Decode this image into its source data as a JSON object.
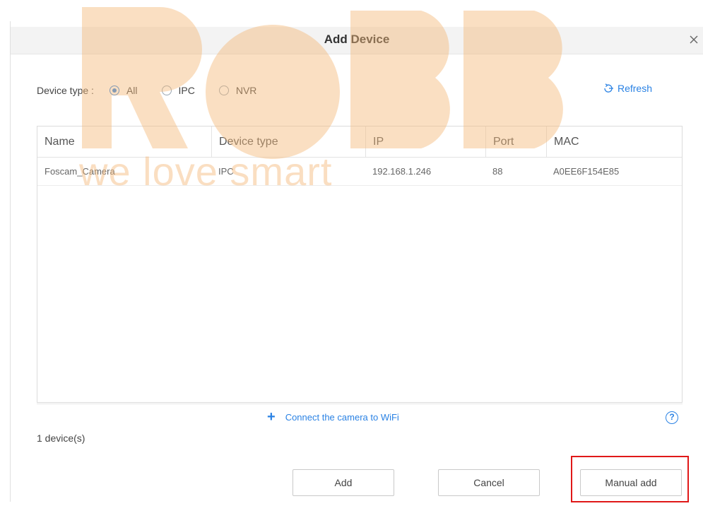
{
  "dialog": {
    "title": "Add Device"
  },
  "filter": {
    "label": "Device type :",
    "options": [
      {
        "label": "All",
        "checked": true
      },
      {
        "label": "IPC",
        "checked": false
      },
      {
        "label": "NVR",
        "checked": false
      }
    ],
    "refresh_label": "Refresh"
  },
  "table": {
    "columns": [
      "Name",
      "Device type",
      "IP",
      "Port",
      "MAC"
    ],
    "rows": [
      {
        "name": "Foscam_Camera",
        "type": "IPC",
        "ip": "192.168.1.246",
        "port": "88",
        "mac": "A0EE6F154E85"
      }
    ]
  },
  "connect": {
    "label": "Connect the camera to WiFi",
    "help": "?"
  },
  "status": {
    "count": "1 device(s)"
  },
  "buttons": {
    "add": "Add",
    "cancel": "Cancel",
    "manual_add": "Manual add"
  },
  "watermark": {
    "logo": "ROBB",
    "tagline": "we love smart"
  },
  "colors": {
    "accent": "#2a82e4",
    "highlight": "#e01818",
    "watermark": "#f4b676"
  },
  "icons": {
    "close": "close-icon",
    "refresh": "refresh-icon",
    "plus": "plus-icon",
    "help": "help-icon"
  }
}
